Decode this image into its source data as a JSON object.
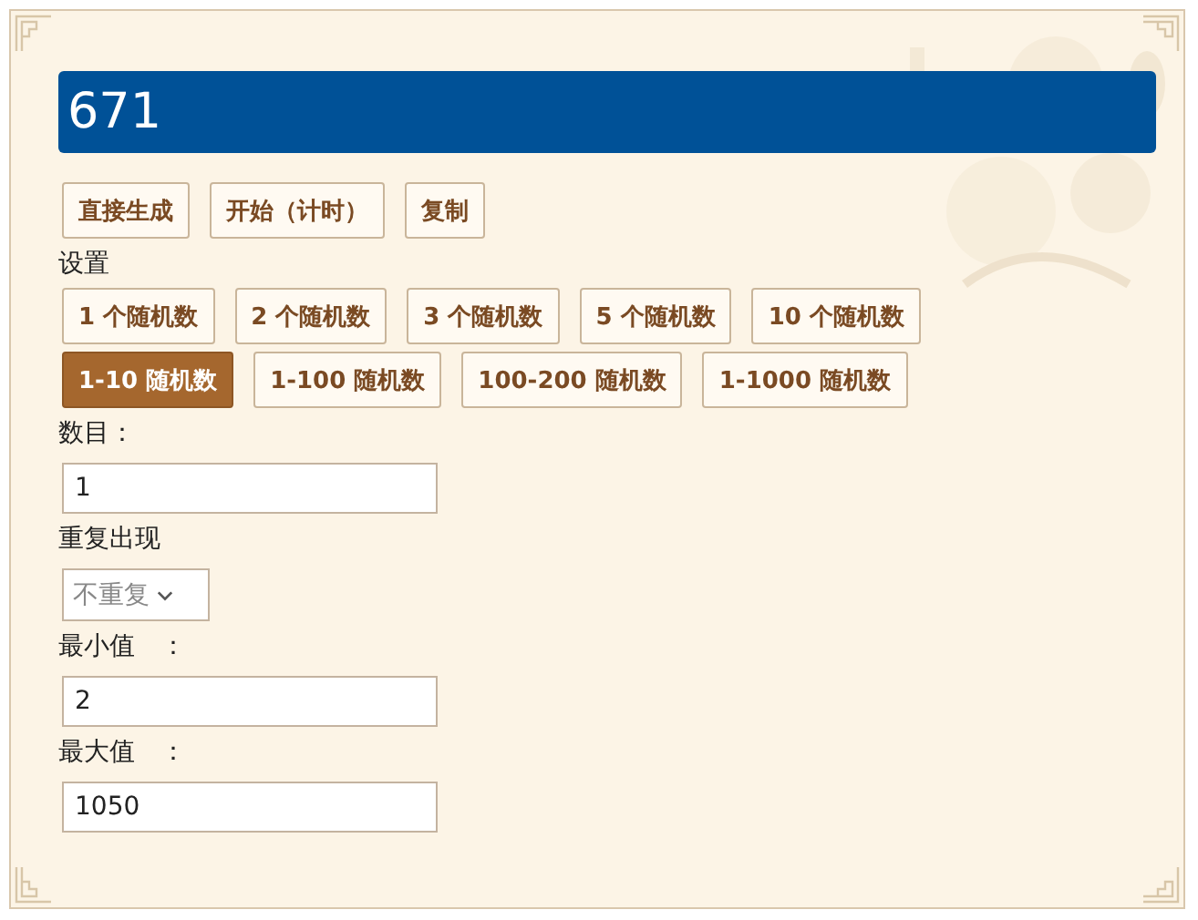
{
  "result": "671",
  "actions": [
    "直接生成",
    "开始（计时）",
    "复制"
  ],
  "settings_label": "设置",
  "count_options": [
    {
      "label": "1 个随机数",
      "selected": false
    },
    {
      "label": "2 个随机数",
      "selected": false
    },
    {
      "label": "3 个随机数",
      "selected": false
    },
    {
      "label": "5 个随机数",
      "selected": false
    },
    {
      "label": "10 个随机数",
      "selected": false
    }
  ],
  "range_options": [
    {
      "label": "1-10 随机数",
      "selected": true
    },
    {
      "label": "1-100 随机数",
      "selected": false
    },
    {
      "label": "100-200 随机数",
      "selected": false
    },
    {
      "label": "1-1000 随机数",
      "selected": false
    }
  ],
  "fields": [
    {
      "kind": "text",
      "label": "数目：",
      "value": "1"
    },
    {
      "kind": "select",
      "label": "重复出现",
      "value": "不重复"
    },
    {
      "kind": "text",
      "label": "最小值　：",
      "value": "2"
    },
    {
      "kind": "text",
      "label": "最大值　：",
      "value": "1050"
    }
  ]
}
